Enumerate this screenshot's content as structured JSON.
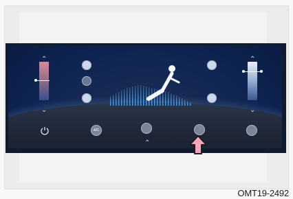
{
  "panel": {
    "ac_label": "A/C",
    "active_button": "rear-defrost"
  },
  "footer": {
    "figure_code": "OMT19-2492"
  }
}
